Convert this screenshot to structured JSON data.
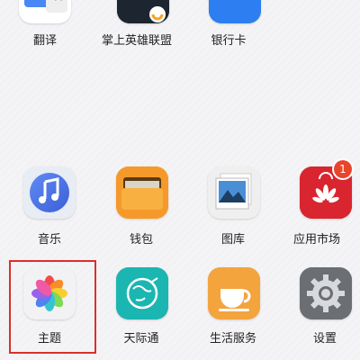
{
  "apps_top": [
    {
      "label": "翻译",
      "icon": "translate-icon"
    },
    {
      "label": "掌上英雄联盟",
      "icon": "league-of-legends-icon"
    },
    {
      "label": "银行卡",
      "icon": "bank-card-icon"
    }
  ],
  "apps_bottom": [
    {
      "label": "音乐",
      "icon": "music-icon"
    },
    {
      "label": "钱包",
      "icon": "wallet-icon"
    },
    {
      "label": "图库",
      "icon": "gallery-icon"
    },
    {
      "label": "应用市场",
      "icon": "app-market-icon",
      "badge": "1"
    },
    {
      "label": "主题",
      "icon": "themes-icon"
    },
    {
      "label": "天际通",
      "icon": "skytone-icon"
    },
    {
      "label": "生活服务",
      "icon": "life-services-icon"
    },
    {
      "label": "设置",
      "icon": "settings-icon"
    }
  ],
  "colors": {
    "highlight": "#d9302a",
    "badge": "#e8452b"
  }
}
